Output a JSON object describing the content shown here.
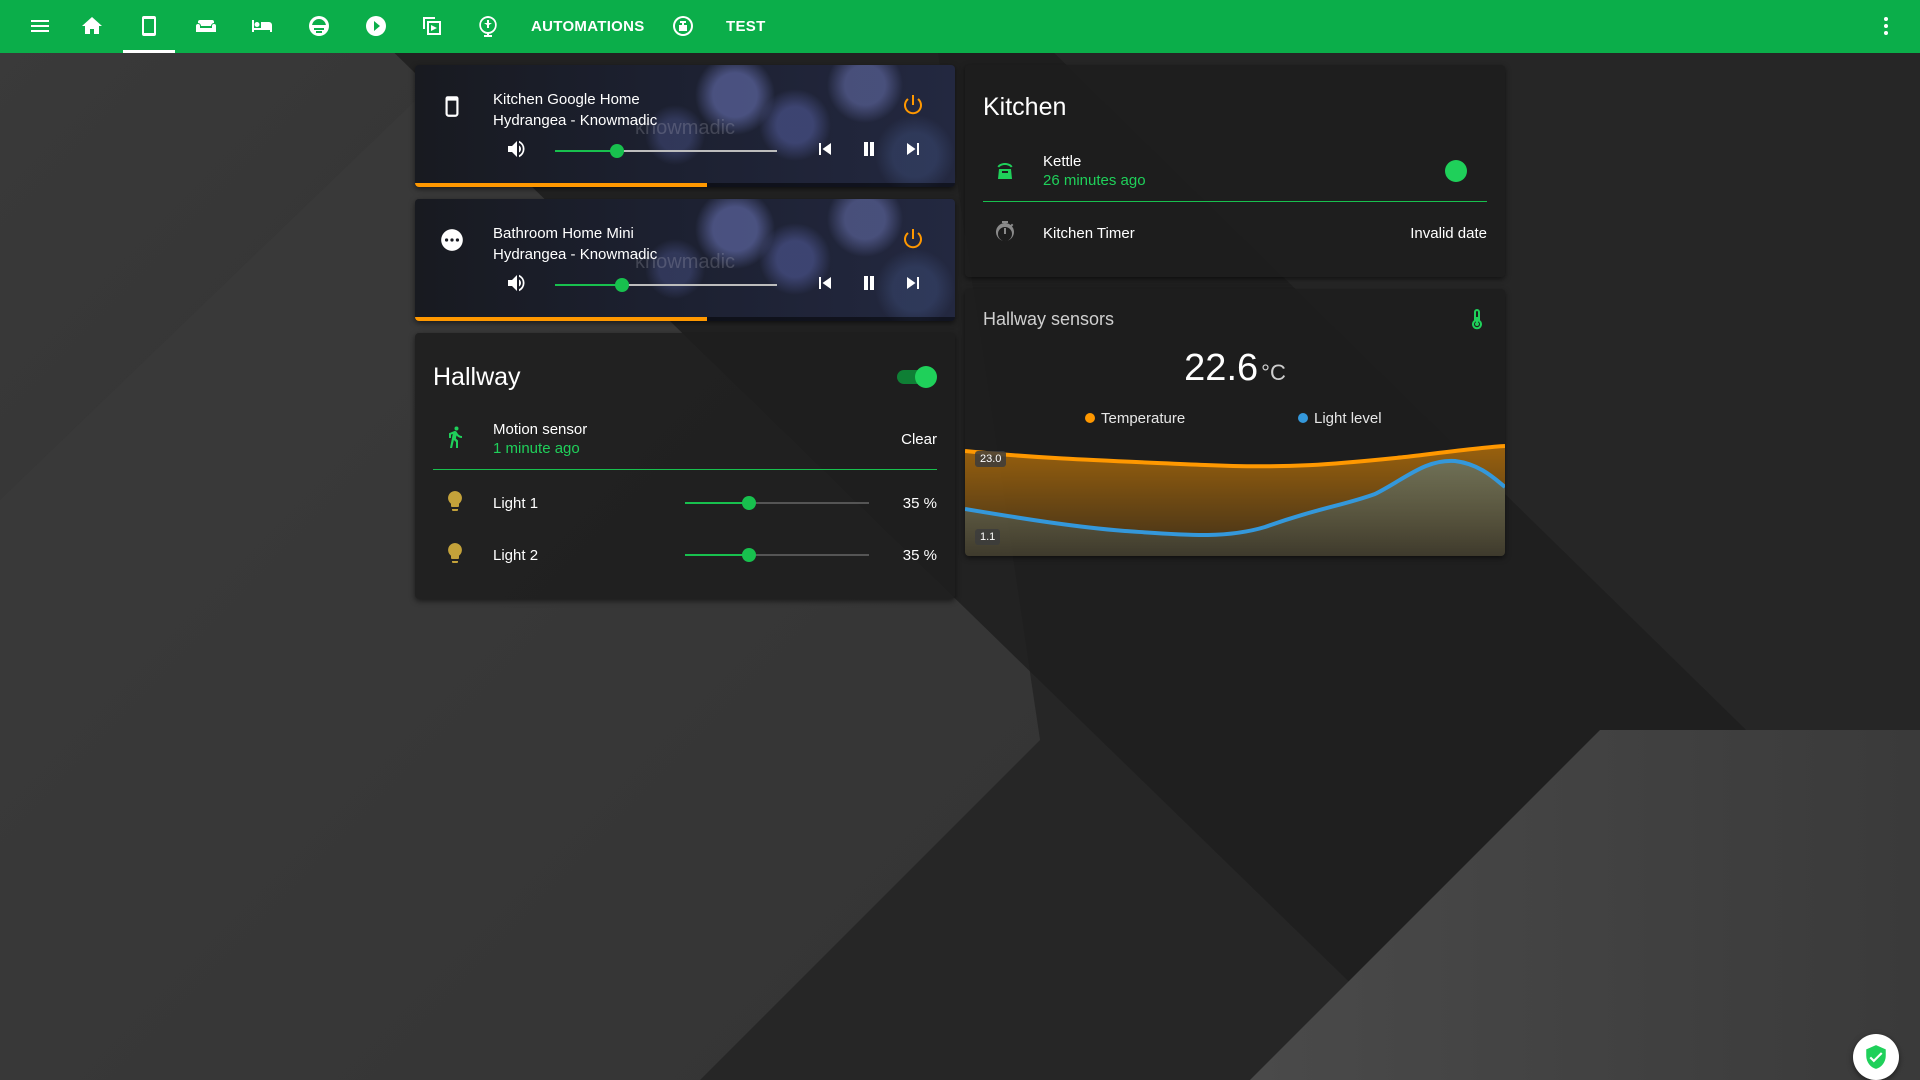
{
  "topbar": {
    "tabs": [
      {
        "icon": "menu-icon"
      },
      {
        "icon": "home-icon"
      },
      {
        "icon": "phone-icon",
        "active": true
      },
      {
        "icon": "sofa-icon"
      },
      {
        "icon": "bed-icon"
      },
      {
        "icon": "weather-icon"
      },
      {
        "icon": "play-icon"
      },
      {
        "icon": "multi-window-icon"
      },
      {
        "icon": "globe-icon"
      },
      {
        "label": "AUTOMATIONS"
      },
      {
        "icon": "robot-icon"
      },
      {
        "label": "TEST"
      }
    ],
    "automations_label": "AUTOMATIONS",
    "test_label": "TEST",
    "overflow_icon": "dots-vertical-icon"
  },
  "media_players": [
    {
      "name": "Kitchen Google Home",
      "track": "Hydrangea - Knowmadic",
      "watermark": "knowmadic",
      "device_icon": "speaker-icon",
      "volume": 0.28,
      "progress": 0.54
    },
    {
      "name": "Bathroom Home Mini",
      "track": "Hydrangea - Knowmadic",
      "watermark": "knowmadic",
      "device_icon": "dots-circle-icon",
      "volume": 0.3,
      "progress": 0.54
    }
  ],
  "hallway": {
    "title": "Hallway",
    "toggle_on": true,
    "motion": {
      "name": "Motion sensor",
      "time": "1 minute ago",
      "state": "Clear"
    },
    "lights": [
      {
        "name": "Light 1",
        "value": "35 %",
        "level": 0.35
      },
      {
        "name": "Light 2",
        "value": "35 %",
        "level": 0.35
      }
    ]
  },
  "kitchen": {
    "title": "Kitchen",
    "kettle": {
      "name": "Kettle",
      "time": "26 minutes ago"
    },
    "timer": {
      "name": "Kitchen Timer",
      "value": "Invalid date"
    }
  },
  "sensors": {
    "title": "Hallway sensors",
    "value": "22.6",
    "unit": "°C",
    "legend": [
      {
        "name": "Temperature",
        "color": "#ff9800"
      },
      {
        "name": "Light level",
        "color": "#3498db"
      }
    ],
    "max_label": "23.0",
    "min_label": "1.1"
  },
  "colors": {
    "accent": "#0bae4a",
    "active_green": "#1fd05a",
    "orange": "#ff9800",
    "blue": "#3498db"
  }
}
